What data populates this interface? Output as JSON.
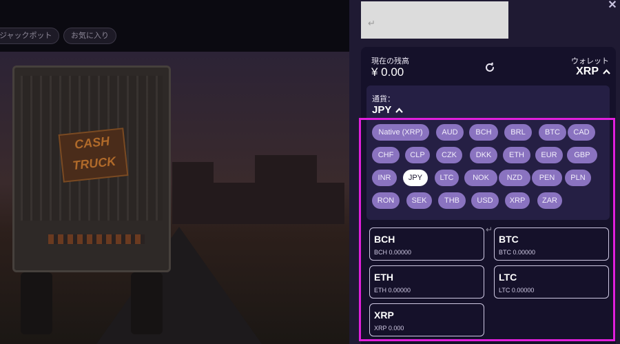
{
  "background": {
    "tags": [
      "ジャックポット",
      "お気に入り"
    ],
    "truck_logo": "CASH TRUCK"
  },
  "banner": {
    "glyph": "↵"
  },
  "balance": {
    "label": "現在の残高",
    "value": "¥ 0.00"
  },
  "wallet": {
    "label": "ウォレット",
    "value": "XRP"
  },
  "currency": {
    "label": "通貨：",
    "value": "JPY"
  },
  "currency_chips": [
    [
      "Native (XRP)",
      "AUD",
      "BCH",
      "BRL",
      "BTC",
      "CAD"
    ],
    [
      "CHF",
      "CLP",
      "CZK",
      "DKK",
      "ETH",
      "EUR",
      "GBP"
    ],
    [
      "INR",
      "JPY",
      "LTC",
      "NOK",
      "NZD",
      "PEN",
      "PLN"
    ],
    [
      "RON",
      "SEK",
      "THB",
      "USD",
      "XRP",
      "ZAR"
    ]
  ],
  "selected_currency": "JPY",
  "coins": [
    {
      "name": "BCH",
      "balance": "BCH 0.00000"
    },
    {
      "name": "BTC",
      "balance": "BTC 0.00000"
    },
    {
      "name": "ETH",
      "balance": "ETH 0.00000"
    },
    {
      "name": "LTC",
      "balance": "LTC 0.00000"
    },
    {
      "name": "XRP",
      "balance": "XRP 0.000"
    }
  ],
  "close_label": "✕",
  "colors": {
    "accent": "#8a73c0",
    "highlight": "#e11fdc",
    "panel": "#1f1a33",
    "card": "#15112a"
  }
}
